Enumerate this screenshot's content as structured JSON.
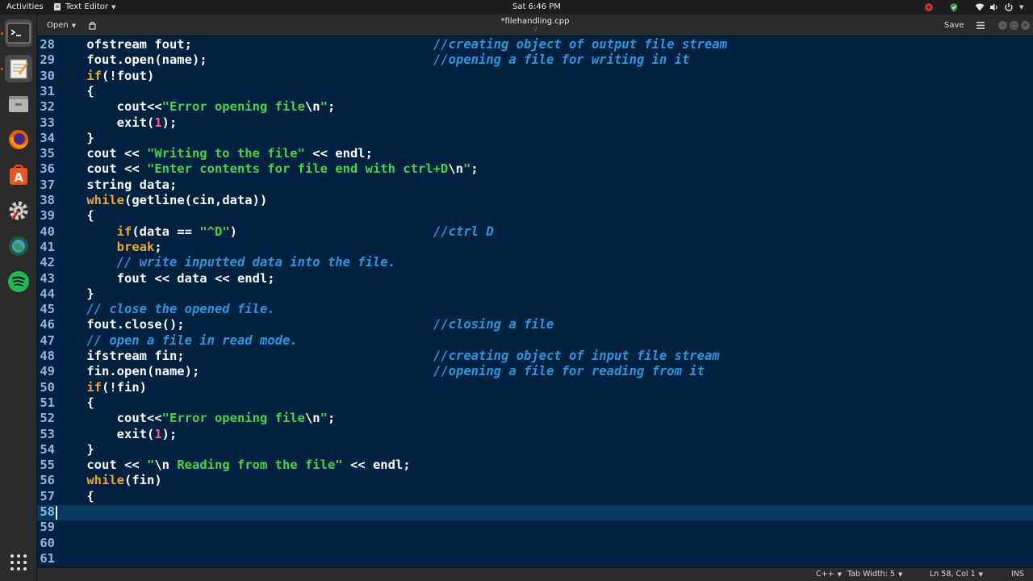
{
  "topbar": {
    "activities": "Activities",
    "app_name": "Text Editor",
    "clock": "Sat  6:46 PM"
  },
  "headerbar": {
    "open_label": "Open",
    "title": "*filehandling.cpp",
    "save_label": "Save"
  },
  "statusbar": {
    "language": "C++",
    "tab_width": "Tab Width: 5",
    "cursor_pos": "Ln 58, Col 1",
    "insert_mode": "INS"
  },
  "colors": {
    "editor_bg": "#002240",
    "current_line": "#073a61",
    "keyword": "#f2a52c",
    "string": "#47d44b",
    "number": "#ff5a8a",
    "comment": "#2c96d8",
    "line_number": "#8fb5e2"
  },
  "editor": {
    "current_line": 58,
    "lines": [
      {
        "n": "28",
        "tokens": [
          {
            "t": "    ofstream fout;",
            "c": ""
          }
        ],
        "comment": "//creating object of output file stream"
      },
      {
        "n": "29",
        "tokens": [
          {
            "t": "    fout.open(name);",
            "c": ""
          }
        ],
        "comment": "//opening a file for writing in it"
      },
      {
        "n": "30",
        "tokens": [
          {
            "t": "    ",
            "c": ""
          },
          {
            "t": "if",
            "c": "kw"
          },
          {
            "t": "(!fout)",
            "c": ""
          }
        ],
        "comment": ""
      },
      {
        "n": "31",
        "tokens": [
          {
            "t": "    {",
            "c": ""
          }
        ],
        "comment": ""
      },
      {
        "n": "32",
        "tokens": [
          {
            "t": "        cout<<",
            "c": ""
          },
          {
            "t": "\"Error opening file",
            "c": "str"
          },
          {
            "t": "\\n",
            "c": ""
          },
          {
            "t": "\"",
            "c": "str"
          },
          {
            "t": ";",
            "c": ""
          }
        ],
        "comment": ""
      },
      {
        "n": "33",
        "tokens": [
          {
            "t": "        exit(",
            "c": ""
          },
          {
            "t": "1",
            "c": "num"
          },
          {
            "t": ");",
            "c": ""
          }
        ],
        "comment": ""
      },
      {
        "n": "34",
        "tokens": [
          {
            "t": "    }",
            "c": ""
          }
        ],
        "comment": ""
      },
      {
        "n": "35",
        "tokens": [
          {
            "t": "    cout << ",
            "c": ""
          },
          {
            "t": "\"Writing to the file\"",
            "c": "str"
          },
          {
            "t": " << endl;",
            "c": ""
          }
        ],
        "comment": ""
      },
      {
        "n": "36",
        "tokens": [
          {
            "t": "    cout << ",
            "c": ""
          },
          {
            "t": "\"Enter contents for file end with ctrl+D",
            "c": "str"
          },
          {
            "t": "\\n",
            "c": ""
          },
          {
            "t": "\"",
            "c": "str"
          },
          {
            "t": ";",
            "c": ""
          }
        ],
        "comment": ""
      },
      {
        "n": "37",
        "tokens": [
          {
            "t": "    string data;",
            "c": ""
          }
        ],
        "comment": ""
      },
      {
        "n": "38",
        "tokens": [
          {
            "t": "    ",
            "c": ""
          },
          {
            "t": "while",
            "c": "kw"
          },
          {
            "t": "(getline(cin,data))",
            "c": ""
          }
        ],
        "comment": ""
      },
      {
        "n": "39",
        "tokens": [
          {
            "t": "    {",
            "c": ""
          }
        ],
        "comment": ""
      },
      {
        "n": "40",
        "tokens": [
          {
            "t": "        ",
            "c": ""
          },
          {
            "t": "if",
            "c": "kw"
          },
          {
            "t": "(data == ",
            "c": ""
          },
          {
            "t": "\"^D\"",
            "c": "str"
          },
          {
            "t": ")",
            "c": ""
          }
        ],
        "comment": "//ctrl D"
      },
      {
        "n": "41",
        "tokens": [
          {
            "t": "        ",
            "c": ""
          },
          {
            "t": "break",
            "c": "kw"
          },
          {
            "t": ";",
            "c": ""
          }
        ],
        "comment": ""
      },
      {
        "n": "42",
        "tokens": [
          {
            "t": "        ",
            "c": ""
          },
          {
            "t": "// write inputted data into the file.",
            "c": "cm"
          }
        ],
        "comment": ""
      },
      {
        "n": "43",
        "tokens": [
          {
            "t": "        fout << data << endl;",
            "c": ""
          }
        ],
        "comment": ""
      },
      {
        "n": "44",
        "tokens": [
          {
            "t": "    }",
            "c": ""
          }
        ],
        "comment": ""
      },
      {
        "n": "45",
        "tokens": [
          {
            "t": "    ",
            "c": ""
          },
          {
            "t": "// close the opened file.",
            "c": "cm"
          }
        ],
        "comment": ""
      },
      {
        "n": "46",
        "tokens": [
          {
            "t": "    fout.close();",
            "c": ""
          }
        ],
        "comment": "//closing a file"
      },
      {
        "n": "47",
        "tokens": [
          {
            "t": "    ",
            "c": ""
          },
          {
            "t": "// open a file in read mode.",
            "c": "cm"
          }
        ],
        "comment": ""
      },
      {
        "n": "48",
        "tokens": [
          {
            "t": "    ifstream fin;",
            "c": ""
          }
        ],
        "comment": "//creating object of input file stream"
      },
      {
        "n": "49",
        "tokens": [
          {
            "t": "    fin.open(name);",
            "c": ""
          }
        ],
        "comment": "//opening a file for reading from it"
      },
      {
        "n": "50",
        "tokens": [
          {
            "t": "    ",
            "c": ""
          },
          {
            "t": "if",
            "c": "kw"
          },
          {
            "t": "(!fin)",
            "c": ""
          }
        ],
        "comment": ""
      },
      {
        "n": "51",
        "tokens": [
          {
            "t": "    {",
            "c": ""
          }
        ],
        "comment": ""
      },
      {
        "n": "52",
        "tokens": [
          {
            "t": "        cout<<",
            "c": ""
          },
          {
            "t": "\"Error opening file",
            "c": "str"
          },
          {
            "t": "\\n",
            "c": ""
          },
          {
            "t": "\"",
            "c": "str"
          },
          {
            "t": ";",
            "c": ""
          }
        ],
        "comment": ""
      },
      {
        "n": "53",
        "tokens": [
          {
            "t": "        exit(",
            "c": ""
          },
          {
            "t": "1",
            "c": "num"
          },
          {
            "t": ");",
            "c": ""
          }
        ],
        "comment": ""
      },
      {
        "n": "54",
        "tokens": [
          {
            "t": "    }",
            "c": ""
          }
        ],
        "comment": ""
      },
      {
        "n": "55",
        "tokens": [
          {
            "t": "    cout << ",
            "c": ""
          },
          {
            "t": "\"",
            "c": "str"
          },
          {
            "t": "\\n",
            "c": ""
          },
          {
            "t": " Reading from the file\"",
            "c": "str"
          },
          {
            "t": " << endl;",
            "c": ""
          }
        ],
        "comment": ""
      },
      {
        "n": "56",
        "tokens": [
          {
            "t": "    ",
            "c": ""
          },
          {
            "t": "while",
            "c": "kw"
          },
          {
            "t": "(fin)",
            "c": ""
          }
        ],
        "comment": ""
      },
      {
        "n": "57",
        "tokens": [
          {
            "t": "    {",
            "c": ""
          }
        ],
        "comment": ""
      },
      {
        "n": "58",
        "tokens": [],
        "comment": ""
      },
      {
        "n": "59",
        "tokens": [],
        "comment": ""
      },
      {
        "n": "60",
        "tokens": [],
        "comment": ""
      },
      {
        "n": "61",
        "tokens": [],
        "comment": ""
      }
    ]
  },
  "dock": {
    "icons": [
      "terminal-icon",
      "text-editor-icon",
      "files-icon",
      "firefox-icon",
      "software-center-icon",
      "settings-icon",
      "web-browser-icon",
      "spotify-icon",
      "show-applications-icon"
    ]
  }
}
